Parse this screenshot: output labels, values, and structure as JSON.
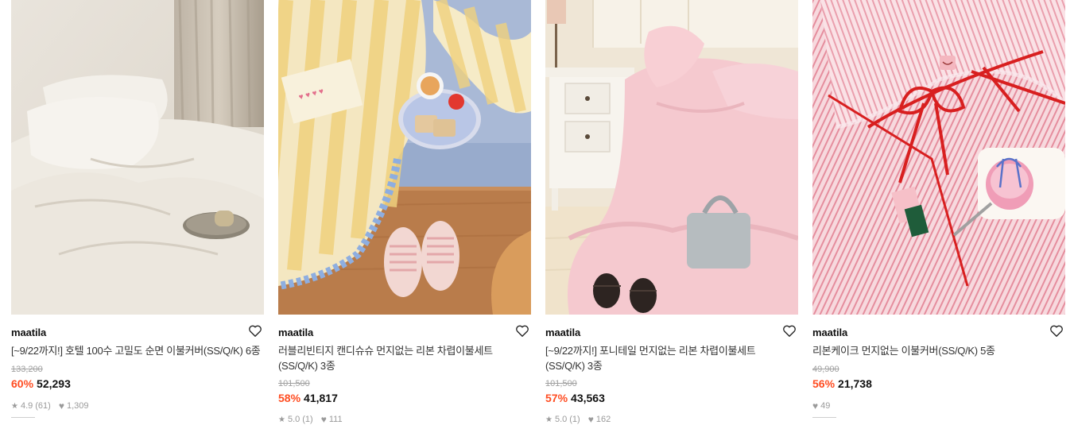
{
  "products": [
    {
      "brand": "maatila",
      "title": "[~9/22까지!] 호텔 100수 고밀도 순면 이불커버(SS/Q/K) 6종",
      "original_price": "133,200",
      "discount": "60%",
      "price": "52,293",
      "rating": "4.9",
      "rating_count": "(61)",
      "likes": "1,309",
      "image": "cream-bedding-photo"
    },
    {
      "brand": "maatila",
      "title": "러블리빈티지 캔디슈슈 먼지없는 리본 차렵이불세트 (SS/Q/K) 3종",
      "original_price": "101,500",
      "discount": "58%",
      "price": "41,817",
      "rating": "5.0",
      "rating_count": "(1)",
      "likes": "111",
      "image": "yellow-stripe-bedding-photo"
    },
    {
      "brand": "maatila",
      "title": "[~9/22까지!] 포니테일 먼지없는 리본 차렵이불세트 (SS/Q/K) 3종",
      "original_price": "101,500",
      "discount": "57%",
      "price": "43,563",
      "rating": "5.0",
      "rating_count": "(1)",
      "likes": "162",
      "image": "pink-bedding-room-photo"
    },
    {
      "brand": "maatila",
      "title": "리본케이크 먼지없는 이불커버(SS/Q/K) 5종",
      "original_price": "49,900",
      "discount": "56%",
      "price": "21,738",
      "likes": "49",
      "image": "pink-stripe-ribbon-bedding-photo"
    }
  ]
}
